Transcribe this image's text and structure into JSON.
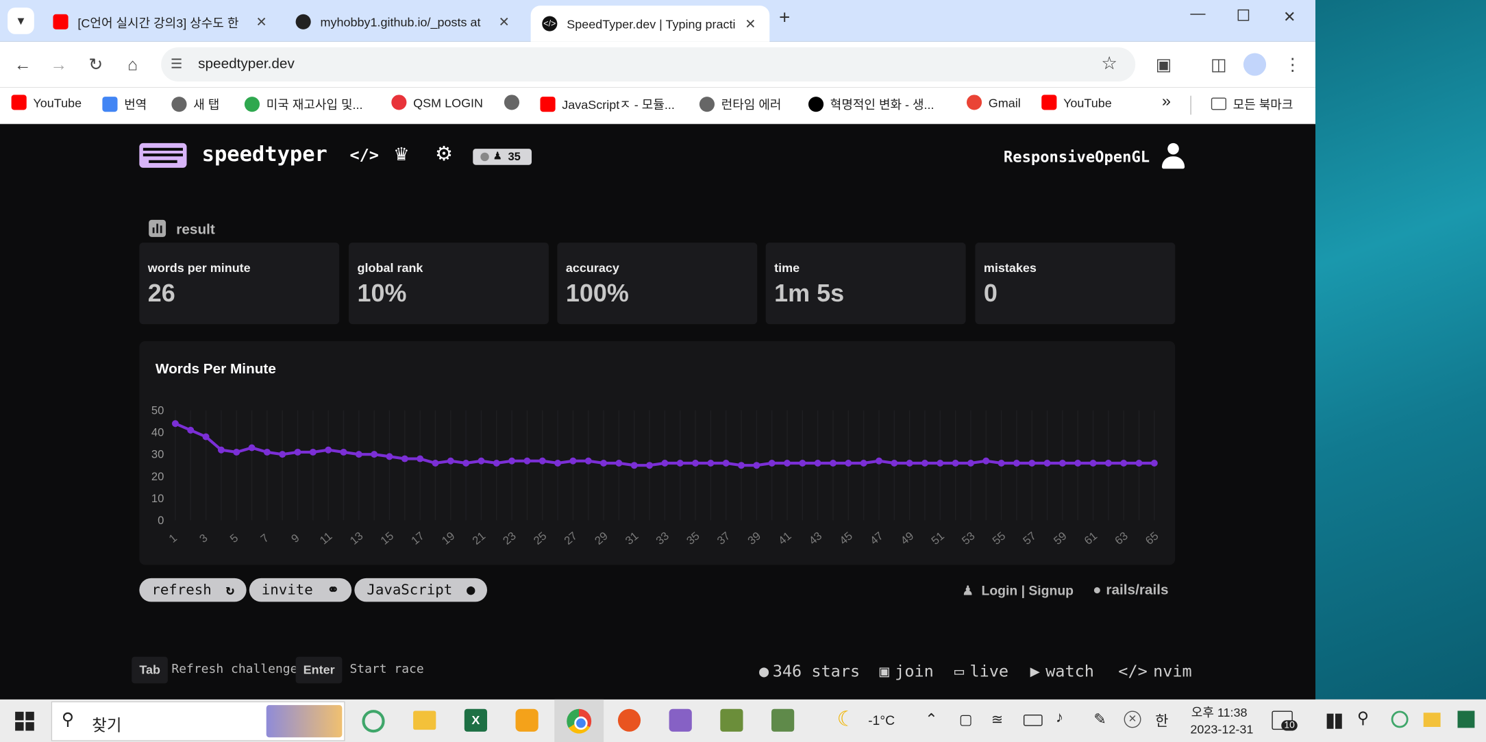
{
  "browser": {
    "tabs": [
      {
        "title": "[C언어 실시간 강의3] 상수도 한",
        "icon": "youtube-icon"
      },
      {
        "title": "myhobby1.github.io/_posts at",
        "icon": "github-icon"
      },
      {
        "title": "SpeedTyper.dev | Typing practi",
        "icon": "code-icon",
        "active": true
      }
    ],
    "url": "speedtyper.dev",
    "bookmarks": [
      "YouTube",
      "번역",
      "새 탭",
      "미국 재고사입 및...",
      "QSM LOGIN",
      "",
      "JavaScriptㅈ - 모듈...",
      "런타임 에러",
      "혁명적인 변화 - 생...",
      "Gmail",
      "YouTube"
    ],
    "all_bookmarks": "모든 북마크",
    "overflow": "»"
  },
  "site": {
    "brand": "speedtyper",
    "online_count": "35",
    "username": "ResponsiveOpenGL",
    "result_title": "result",
    "stats": [
      {
        "label": "words per minute",
        "value": "26"
      },
      {
        "label": "global rank",
        "value": "10%"
      },
      {
        "label": "accuracy",
        "value": "100%"
      },
      {
        "label": "time",
        "value": "1m 5s"
      },
      {
        "label": "mistakes",
        "value": "0"
      }
    ],
    "chart_title": "Words Per Minute",
    "buttons": {
      "refresh": "refresh",
      "invite": "invite",
      "language": "JavaScript"
    },
    "login": "Login | Signup",
    "repo": "rails/rails",
    "keys": [
      {
        "key": "Tab",
        "desc": "Refresh challenge"
      },
      {
        "key": "Enter",
        "desc": "Start race"
      }
    ],
    "footer": {
      "stars": "346 stars",
      "join": "join",
      "live": "live",
      "watch": "watch",
      "nvim": "nvim"
    },
    "accent": "#7b2fd6"
  },
  "chart_data": {
    "type": "line",
    "title": "Words Per Minute",
    "x": [
      1,
      2,
      3,
      4,
      5,
      6,
      7,
      8,
      9,
      10,
      11,
      12,
      13,
      14,
      15,
      16,
      17,
      18,
      19,
      20,
      21,
      22,
      23,
      24,
      25,
      26,
      27,
      28,
      29,
      30,
      31,
      32,
      33,
      34,
      35,
      36,
      37,
      38,
      39,
      40,
      41,
      42,
      43,
      44,
      45,
      46,
      47,
      48,
      49,
      50,
      51,
      52,
      53,
      54,
      55,
      56,
      57,
      58,
      59,
      60,
      61,
      62,
      63,
      64,
      65
    ],
    "x_tick_labels": [
      "1",
      "3",
      "5",
      "7",
      "9",
      "11",
      "13",
      "15",
      "17",
      "19",
      "21",
      "23",
      "25",
      "27",
      "29",
      "31",
      "33",
      "35",
      "37",
      "39",
      "41",
      "43",
      "45",
      "47",
      "49",
      "51",
      "53",
      "55",
      "57",
      "59",
      "61",
      "63",
      "65"
    ],
    "y_ticks": [
      0,
      10,
      20,
      30,
      40,
      50
    ],
    "ylim": [
      0,
      50
    ],
    "series": [
      {
        "values": [
          44,
          41,
          38,
          32,
          31,
          33,
          31,
          30,
          31,
          31,
          32,
          31,
          30,
          30,
          29,
          28,
          28,
          26,
          27,
          26,
          27,
          26,
          27,
          27,
          27,
          26,
          27,
          27,
          26,
          26,
          25,
          25,
          26,
          26,
          26,
          26,
          26,
          25,
          25,
          26,
          26,
          26,
          26,
          26,
          26,
          26,
          27,
          26,
          26,
          26,
          26,
          26,
          26,
          27,
          26,
          26,
          26,
          26,
          26,
          26,
          26,
          26,
          26,
          26,
          26
        ],
        "color": "#7b2fd6"
      }
    ],
    "grid": true
  },
  "taskbar": {
    "search_placeholder": "찾기",
    "weather": "-1°C",
    "ime": "한",
    "time": "오후 11:38",
    "date": "2023-12-31",
    "notifications": "10"
  }
}
